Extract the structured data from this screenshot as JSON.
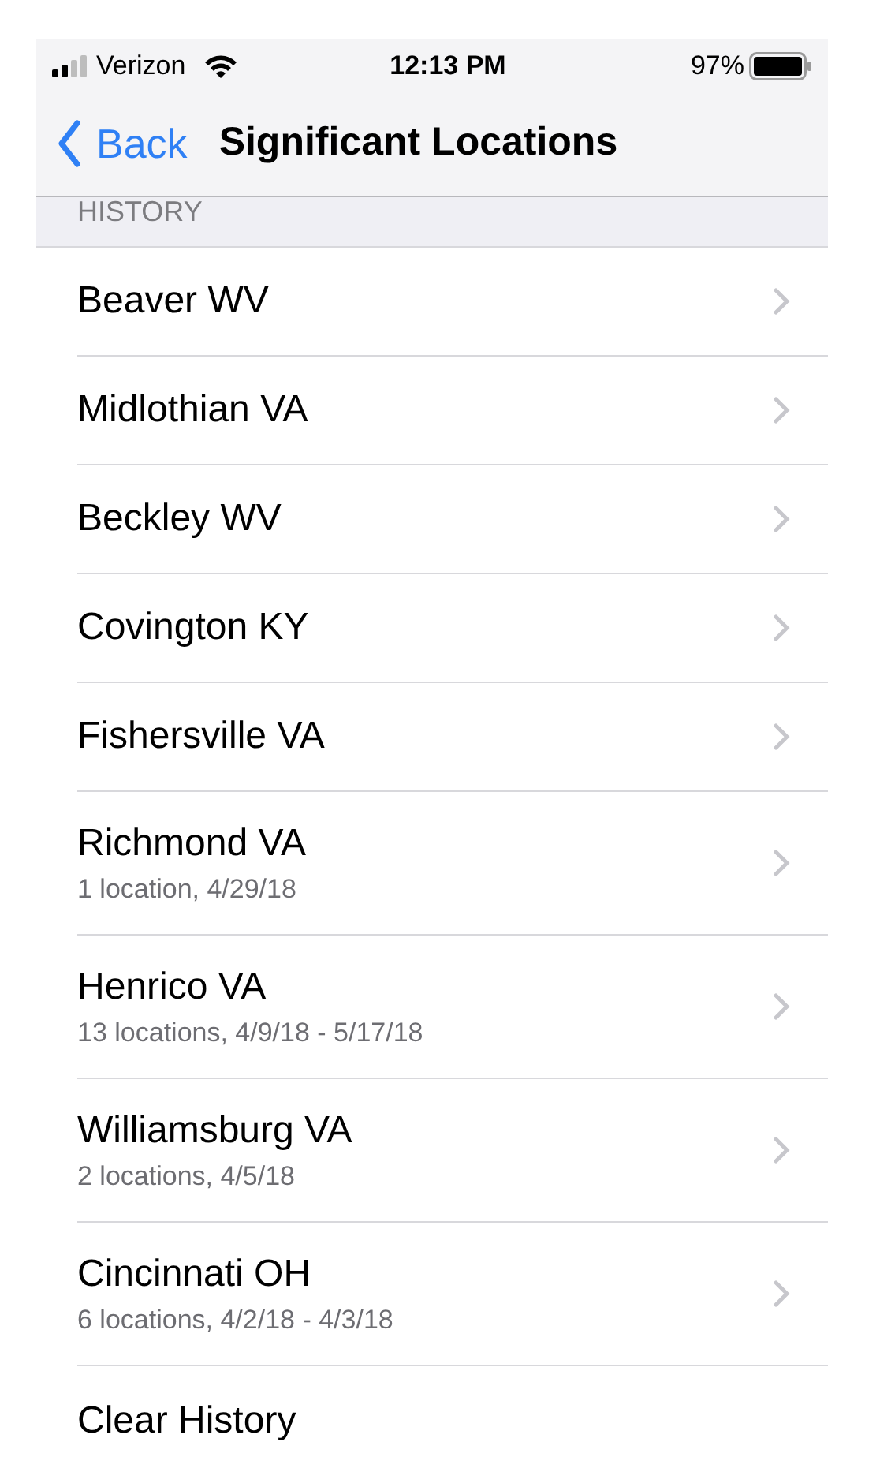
{
  "status_bar": {
    "carrier": "Verizon",
    "time": "12:13 PM",
    "battery": "97%"
  },
  "nav": {
    "back": "Back",
    "title": "Significant Locations"
  },
  "section_header": "HISTORY",
  "rows": [
    {
      "kind": "link",
      "title": "Beaver WV"
    },
    {
      "kind": "link",
      "title": "Midlothian VA"
    },
    {
      "kind": "link",
      "title": "Beckley WV"
    },
    {
      "kind": "link",
      "title": "Covington KY"
    },
    {
      "kind": "link",
      "title": "Fishersville VA"
    },
    {
      "kind": "link",
      "title": "Richmond VA",
      "subtitle": "1 location, 4/29/18"
    },
    {
      "kind": "link",
      "title": "Henrico VA",
      "subtitle": "13 locations, 4/9/18 - 5/17/18"
    },
    {
      "kind": "link",
      "title": "Williamsburg VA",
      "subtitle": "2 locations, 4/5/18"
    },
    {
      "kind": "link",
      "title": "Cincinnati OH",
      "subtitle": "6 locations, 4/2/18 - 4/3/18"
    },
    {
      "kind": "action",
      "title": "Clear History"
    }
  ]
}
